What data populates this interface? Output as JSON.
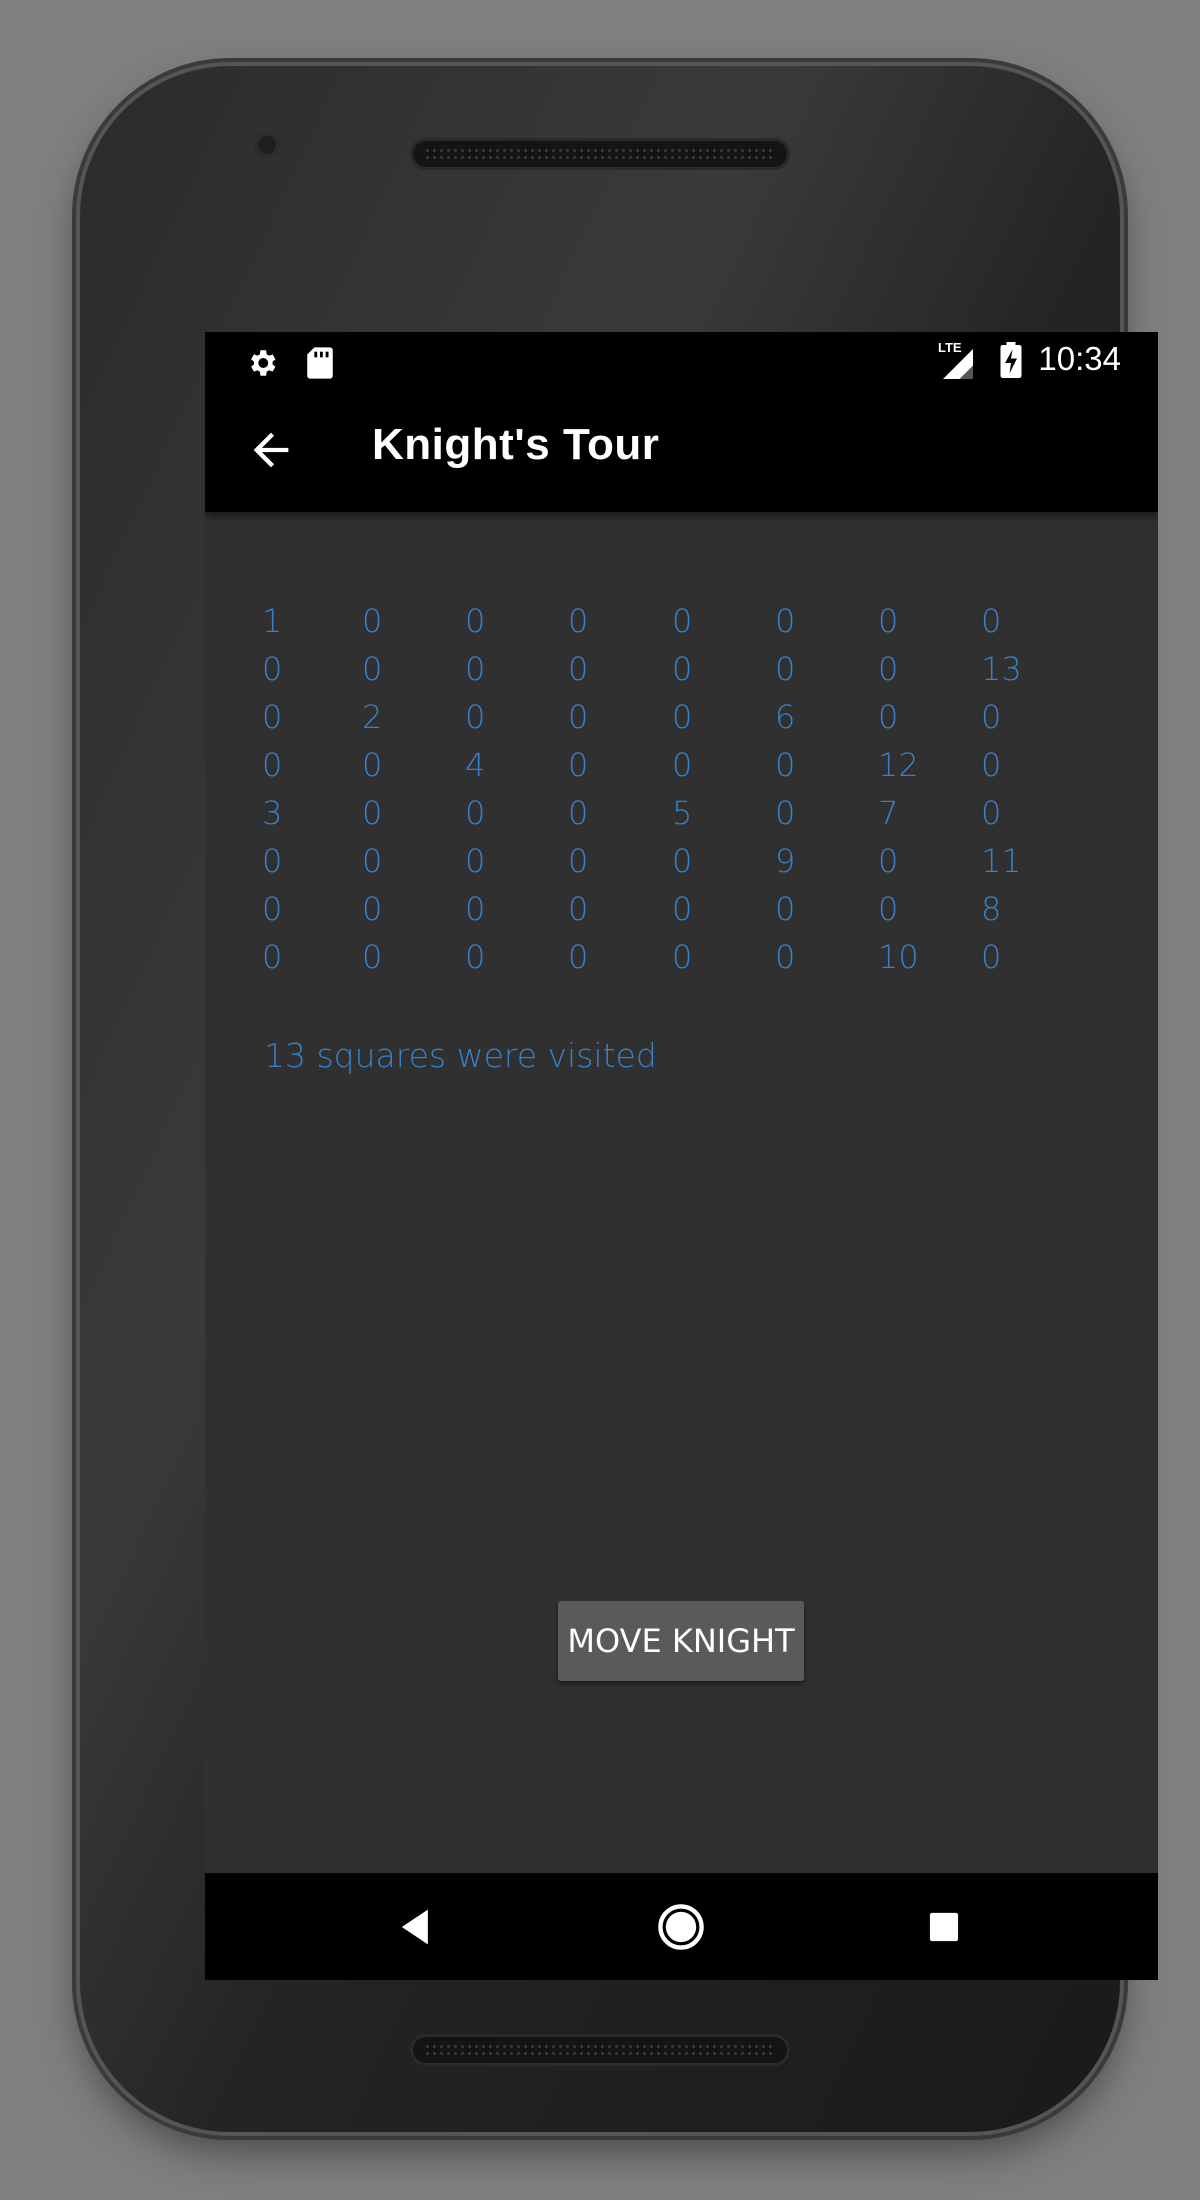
{
  "status_bar": {
    "time": "10:34",
    "left_icons": [
      "gear-icon",
      "sd-card-icon"
    ],
    "network_label": "LTE",
    "right_icons": [
      "signal-icon",
      "battery-charging-icon"
    ]
  },
  "app_bar": {
    "title": "Knight's Tour",
    "back_icon": "arrow-left-icon"
  },
  "board": {
    "rows": [
      [
        "1",
        "0",
        "0",
        "0",
        "0",
        "0",
        "0",
        "0"
      ],
      [
        "0",
        "0",
        "0",
        "0",
        "0",
        "0",
        "0",
        "13"
      ],
      [
        "0",
        "2",
        "0",
        "0",
        "0",
        "6",
        "0",
        "0"
      ],
      [
        "0",
        "0",
        "4",
        "0",
        "0",
        "0",
        "12",
        "0"
      ],
      [
        "3",
        "0",
        "0",
        "0",
        "5",
        "0",
        "7",
        "0"
      ],
      [
        "0",
        "0",
        "0",
        "0",
        "0",
        "9",
        "0",
        "11"
      ],
      [
        "0",
        "0",
        "0",
        "0",
        "0",
        "0",
        "0",
        "8"
      ],
      [
        "0",
        "0",
        "0",
        "0",
        "0",
        "0",
        "10",
        "0"
      ]
    ]
  },
  "visited_text": "13 squares were visited",
  "move_button": {
    "label": "MOVE KNIGHT"
  },
  "nav_bar": {
    "back_icon": "nav-back-icon",
    "home_icon": "nav-home-icon",
    "recents_icon": "nav-recents-icon"
  },
  "colors": {
    "accent_text": "#3a80c8",
    "screen_background": "#303030",
    "bar_background": "#000000",
    "button_background": "#5a5a5a"
  }
}
